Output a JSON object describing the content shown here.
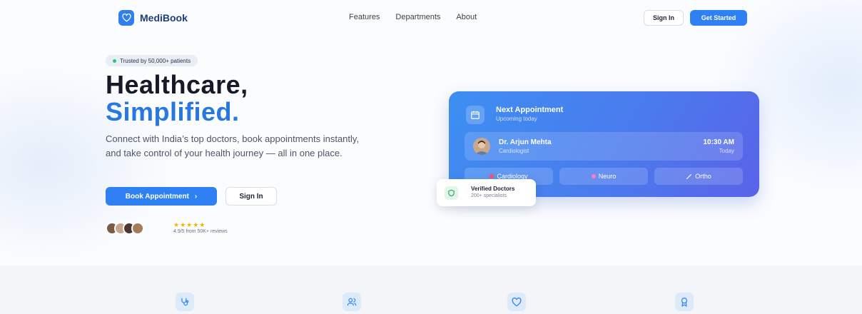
{
  "brand": {
    "name": "MediBook",
    "logo_icon": "heart-icon"
  },
  "nav": {
    "items": [
      "Features",
      "Departments",
      "About"
    ]
  },
  "header": {
    "signin_label": "Sign In",
    "get_started_label": "Get Started"
  },
  "hero": {
    "trust_badge": "Trusted by 50,000+ patients",
    "headline_line1": "Healthcare,",
    "headline_line2": "Simplified.",
    "subtext": "Connect with India’s top doctors, book appointments instantly, and take control of your health journey — all in one place.",
    "book_label": "Book Appointment",
    "book_chevron": "›",
    "signin_label": "Sign In",
    "stars": "★★★★★",
    "rating": "4.9/5 from 50K+ reviews"
  },
  "appointment": {
    "title": "Next Appointment",
    "subtitle": "Upcoming today",
    "doctor_name": "Dr. Arjun Mehta",
    "doctor_role": "Cardiologist",
    "time": "10:30 AM",
    "day": "Today",
    "departments": [
      {
        "label": "Cardiology",
        "color": "#ff4d6d"
      },
      {
        "label": "Neuro",
        "color": "#ff7bc6"
      },
      {
        "label": "Ortho",
        "icon": "bone-icon"
      }
    ]
  },
  "verified": {
    "title": "Verified Doctors",
    "subtitle": "200+ specialists"
  },
  "features": {
    "icons": [
      "stethoscope-icon",
      "users-icon",
      "heart-icon",
      "award-icon"
    ]
  },
  "colors": {
    "primary": "#2f80f2",
    "headline_accent": "#2879df",
    "success": "#2ec27e"
  }
}
